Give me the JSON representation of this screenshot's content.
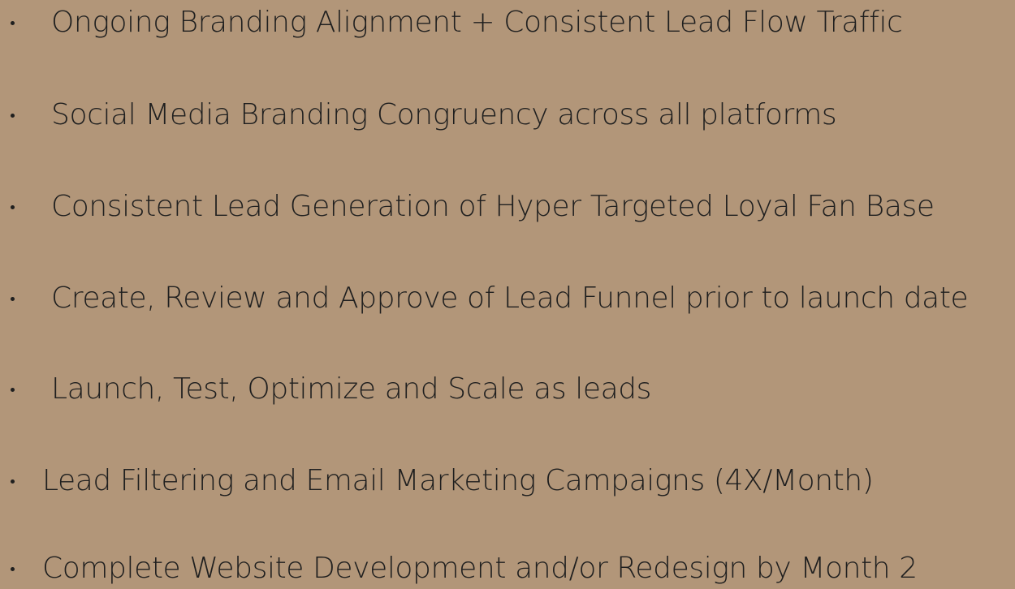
{
  "colors": {
    "background": "#b29679",
    "text": "#1f1f1f"
  },
  "items": [
    {
      "label": "Ongoing Branding Alignment + Consistent Lead Flow Traffic"
    },
    {
      "label": "Social Media Branding Congruency across all platforms"
    },
    {
      "label": "Consistent Lead Generation of Hyper Targeted Loyal Fan Base"
    },
    {
      "label": "Create, Review and Approve of Lead Funnel prior to launch date"
    },
    {
      "label": "Launch, Test, Optimize and Scale as leads"
    },
    {
      "label": "Lead Filtering and Email Marketing Campaigns (4X/Month)"
    },
    {
      "label": "Complete Website Development and/or Redesign by Month 2"
    }
  ]
}
